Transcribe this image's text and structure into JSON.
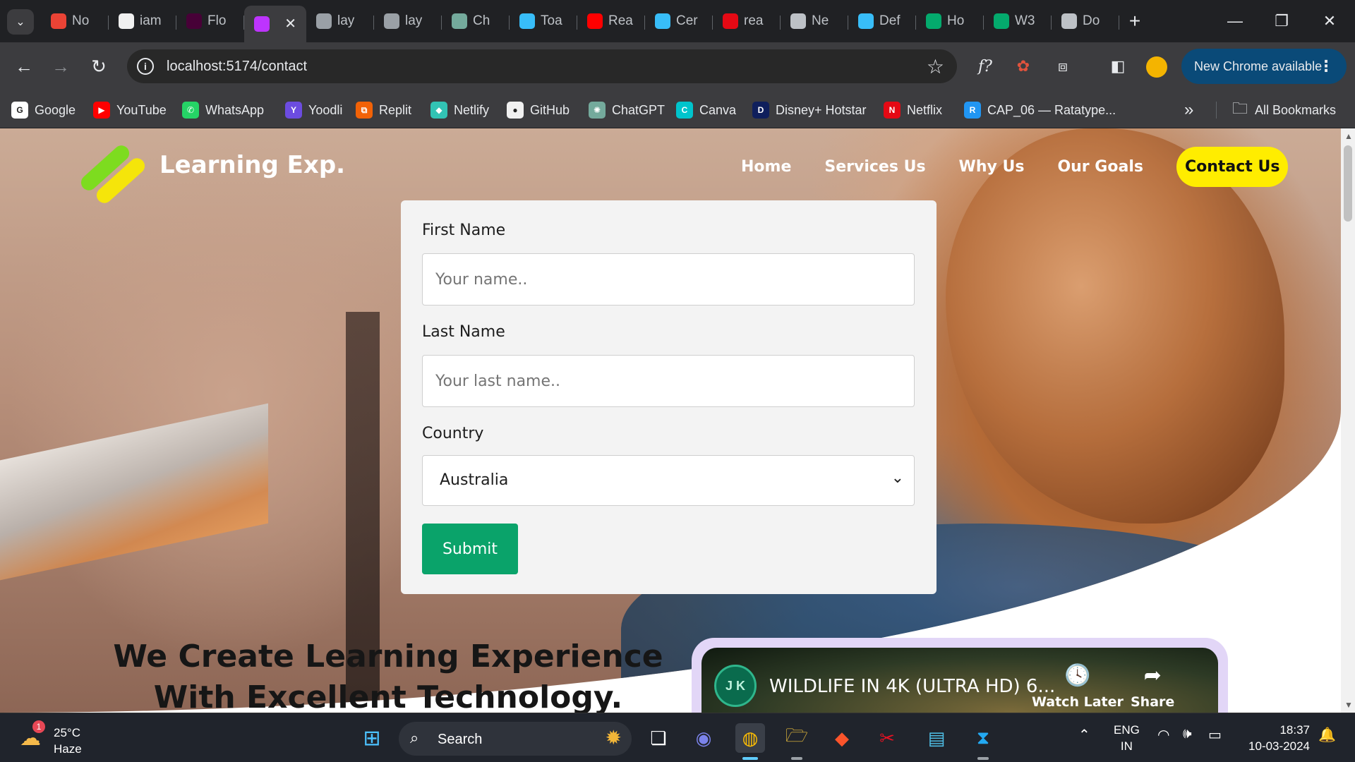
{
  "browser": {
    "tabs": [
      {
        "label": "No",
        "icon": "gmail-icon",
        "color": "#ea4335"
      },
      {
        "label": "iam",
        "icon": "github-icon",
        "color": "#f0f0f0"
      },
      {
        "label": "Flo",
        "icon": "xd-icon",
        "color": "#470137"
      },
      {
        "label": "",
        "icon": "vite-icon",
        "color": "#bd34fe",
        "active": true
      },
      {
        "label": "lay",
        "icon": "globe-icon",
        "color": "#9aa0a6"
      },
      {
        "label": "lay",
        "icon": "globe-icon",
        "color": "#9aa0a6"
      },
      {
        "label": "Ch",
        "icon": "chatgpt-icon",
        "color": "#74aa9c"
      },
      {
        "label": "Toa",
        "icon": "bolt-icon",
        "color": "#38bdf8"
      },
      {
        "label": "Rea",
        "icon": "youtube-icon",
        "color": "#ff0000"
      },
      {
        "label": "Cer",
        "icon": "bolt-icon",
        "color": "#38bdf8"
      },
      {
        "label": "rea",
        "icon": "netflix-icon",
        "color": "#e50914"
      },
      {
        "label": "Ne",
        "icon": "chrome-icon",
        "color": "#bdc1c6"
      },
      {
        "label": "Def",
        "icon": "bolt-icon",
        "color": "#38bdf8"
      },
      {
        "label": "Ho",
        "icon": "w3-icon",
        "color": "#04aa6d"
      },
      {
        "label": "W3",
        "icon": "w3-icon",
        "color": "#04aa6d"
      },
      {
        "label": "Do",
        "icon": "download-icon",
        "color": "#bdc1c6"
      }
    ],
    "active_close": "✕",
    "new_tab": "+",
    "url": "localhost:5174/contact",
    "update_label": "New Chrome available",
    "bookmarks": [
      {
        "label": "Google",
        "icon": "google-icon",
        "color": "#ffffff",
        "glyph": "G"
      },
      {
        "label": "YouTube",
        "icon": "youtube-icon",
        "color": "#ff0000",
        "glyph": "▶"
      },
      {
        "label": "WhatsApp",
        "icon": "whatsapp-icon",
        "color": "#25d366",
        "glyph": "✆"
      },
      {
        "label": "Yoodli",
        "icon": "yoodli-icon",
        "color": "#6c4ce0",
        "glyph": "Y"
      },
      {
        "label": "Replit",
        "icon": "replit-icon",
        "color": "#f26207",
        "glyph": "⧉"
      },
      {
        "label": "Netlify",
        "icon": "netlify-icon",
        "color": "#32c3b4",
        "glyph": "◆"
      },
      {
        "label": "GitHub",
        "icon": "github-icon",
        "color": "#f0f0f0",
        "glyph": "●"
      },
      {
        "label": "ChatGPT",
        "icon": "chatgpt-icon",
        "color": "#74aa9c",
        "glyph": "✺"
      },
      {
        "label": "Canva",
        "icon": "canva-icon",
        "color": "#00c4cc",
        "glyph": "C"
      },
      {
        "label": "Disney+ Hotstar",
        "icon": "hotstar-icon",
        "color": "#0f1f5c",
        "glyph": "D"
      },
      {
        "label": "Netflix",
        "icon": "netflix-icon",
        "color": "#e50914",
        "glyph": "N"
      },
      {
        "label": "CAP_06 — Ratatype...",
        "icon": "ratatype-icon",
        "color": "#2196f3",
        "glyph": "R"
      }
    ],
    "more_bookmarks": "»",
    "all_bookmarks": "All Bookmarks"
  },
  "site": {
    "logo_text": "Learning Exp.",
    "logo_colors": [
      "#7ddc1f",
      "#f5e50a"
    ],
    "nav": [
      "Home",
      "Services Us",
      "Why Us",
      "Our Goals"
    ],
    "nav_cta": "Contact Us",
    "accent_yellow": "#ffed00",
    "form": {
      "first_name_label": "First Name",
      "first_name_placeholder": "Your name..",
      "last_name_label": "Last Name",
      "last_name_placeholder": "Your last name..",
      "country_label": "Country",
      "country_value": "Australia",
      "submit_label": "Submit",
      "submit_color": "#0aa36a"
    },
    "headline_line1": "We Create Learning Experience",
    "headline_line2": "With Excellent Technology.",
    "video": {
      "channel_initials": "J K",
      "title": "WILDLIFE IN 4K (ULTRA HD) 6...",
      "watch_later": "Watch Later",
      "share": "Share"
    }
  },
  "taskbar": {
    "weather_temp": "25°C",
    "weather_condition": "Haze",
    "weather_badge": "1",
    "search_label": "Search",
    "lang_line1": "ENG",
    "lang_line2": "IN",
    "time": "18:37",
    "date": "10-03-2024"
  }
}
